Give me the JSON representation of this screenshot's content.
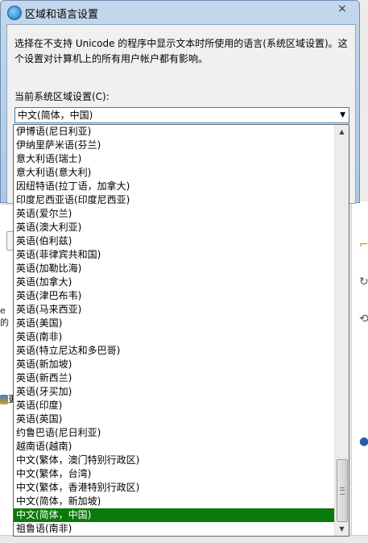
{
  "dialog": {
    "title": "区域和语言设置",
    "close_glyph": "×",
    "description": "选择在不支持 Unicode 的程序中显示文本时所使用的语言(系统区域设置)。这个设置对计算机上的所有用户帐户都有影响。",
    "current_label": "当前系统区域设置(C):",
    "current_value": "中文(简体，中国)"
  },
  "dropdown": {
    "items": [
      "伊博语(尼日利亚)",
      "伊纳里萨米语(芬兰)",
      "意大利语(瑞士)",
      "意大利语(意大利)",
      "因纽特语(拉丁语，加拿大)",
      "印度尼西亚语(印度尼西亚)",
      "英语(爱尔兰)",
      "英语(澳大利亚)",
      "英语(伯利兹)",
      "英语(菲律宾共和国)",
      "英语(加勒比海)",
      "英语(加拿大)",
      "英语(津巴布韦)",
      "英语(马来西亚)",
      "英语(美国)",
      "英语(南非)",
      "英语(特立尼达和多巴哥)",
      "英语(新加坡)",
      "英语(新西兰)",
      "英语(牙买加)",
      "英语(印度)",
      "英语(英国)",
      "约鲁巴语(尼日利亚)",
      "越南语(越南)",
      "中文(繁体，澳门特别行政区)",
      "中文(繁体，台湾)",
      "中文(繁体，香港特别行政区)",
      "中文(简体，新加坡)",
      "中文(简体，中国)",
      "祖鲁语(南非)"
    ],
    "selected_index": 28
  },
  "background": {
    "left_text": "e 的",
    "update_text": "更"
  },
  "colors": {
    "selection": "#0a7a0a",
    "title_gradient_top": "#c4d7ec"
  }
}
